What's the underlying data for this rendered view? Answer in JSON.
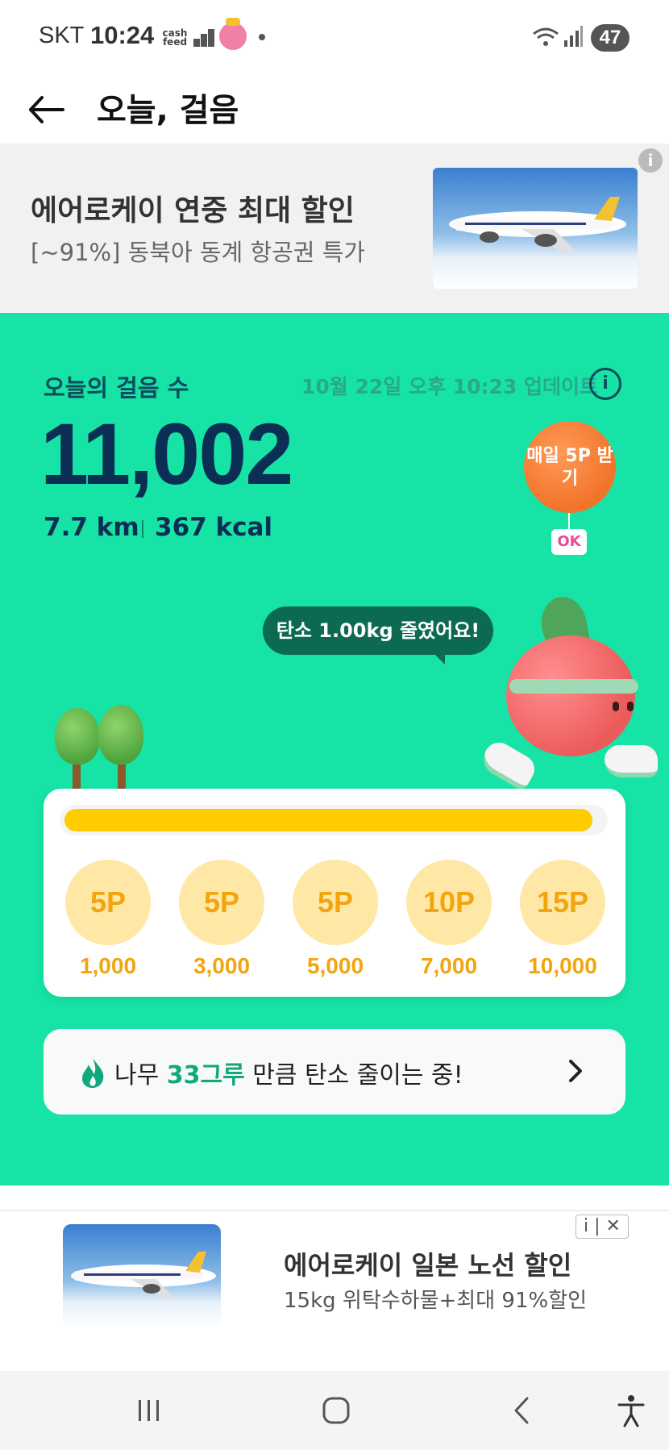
{
  "status_bar": {
    "carrier": "SKT",
    "time": "10:24",
    "app_badge": "cash\nfeed",
    "battery": "47"
  },
  "header": {
    "title": "오늘, 걸음"
  },
  "ad_top": {
    "title": "에어로케이 연중 최대 할인",
    "subtitle": "[~91%] 동북아 동계 항공권 특가",
    "info": "i"
  },
  "steps": {
    "label": "오늘의 걸음 수",
    "updated": "10월 22일 오후 10:23 업데이트",
    "info": "i",
    "count": "11,002",
    "distance": "7.7 km",
    "kcal": "367 kcal"
  },
  "balloon": {
    "text": "매일 5P 받기",
    "badge": "OK"
  },
  "speech": {
    "text": "탄소 1.00kg 줄였어요!"
  },
  "progress": {
    "fraction": 0.98
  },
  "rewards": [
    {
      "points": "5P",
      "steps": "1,000"
    },
    {
      "points": "5P",
      "steps": "3,000"
    },
    {
      "points": "5P",
      "steps": "5,000"
    },
    {
      "points": "10P",
      "steps": "7,000"
    },
    {
      "points": "15P",
      "steps": "10,000"
    }
  ],
  "carbon": {
    "prefix": "나무 ",
    "highlight": "33그루",
    "suffix": " 만큼 탄소 줄이는 중!"
  },
  "ad_bottom": {
    "title": "에어로케이 일본 노선 할인",
    "subtitle": "15kg 위탁수하물+최대 91%할인",
    "controls": "i | ✕"
  },
  "colors": {
    "accent_green": "#16e3a5",
    "dark_navy": "#0b2e55",
    "reward_gold": "#f2a510",
    "progress_yellow": "#ffcc00"
  },
  "icons": [
    "back-arrow-icon",
    "info-icon",
    "fire-icon",
    "chevron-right-icon",
    "recent-apps-icon",
    "home-icon",
    "back-nav-icon",
    "accessibility-icon"
  ]
}
